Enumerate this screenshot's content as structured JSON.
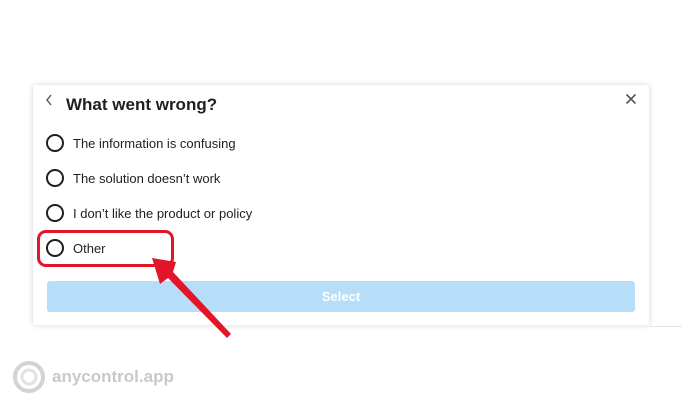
{
  "dialog": {
    "title": "What went wrong?",
    "options": [
      {
        "label": "The information is confusing"
      },
      {
        "label": "The solution doesn’t work"
      },
      {
        "label": "I don’t like the product or policy"
      },
      {
        "label": "Other"
      }
    ],
    "select_label": "Select"
  },
  "annotation": {
    "highlighted_option": "Other",
    "color": "#e3152a"
  },
  "watermark": {
    "text": "anycontrol.app"
  },
  "colors": {
    "select_button_bg": "#b6def8",
    "text": "#1f1f1f"
  },
  "icons": {
    "back": "chevron-left-icon",
    "close": "close-icon",
    "watermark_logo": "anycontrol-logo-icon"
  }
}
